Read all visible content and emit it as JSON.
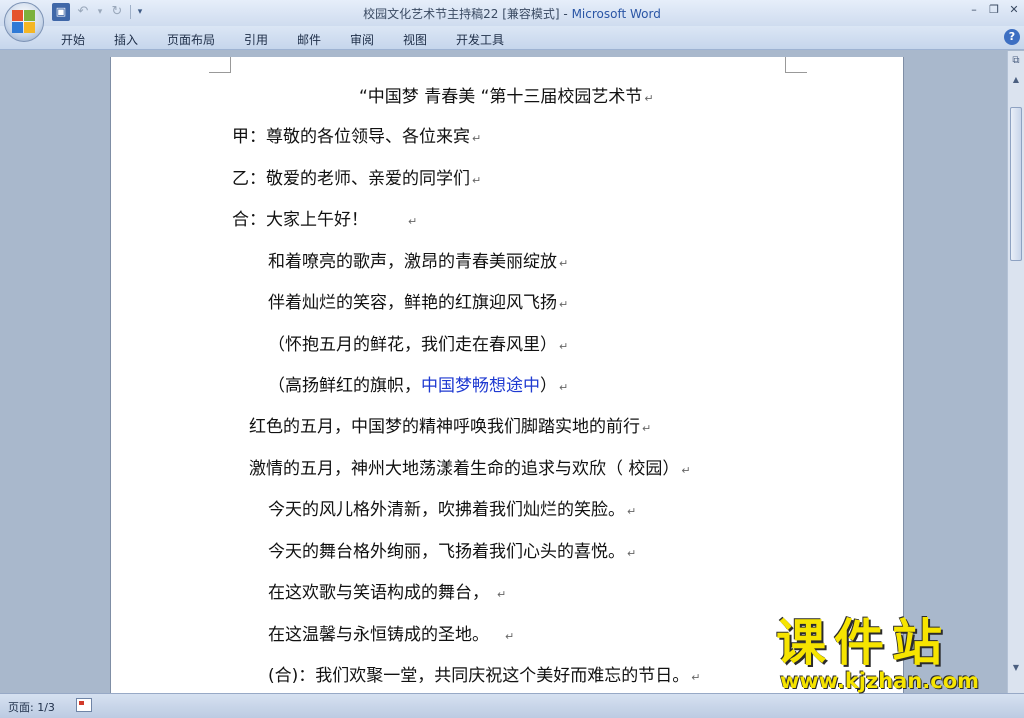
{
  "window": {
    "title": "校园文化艺术节主持稿22 [兼容模式]",
    "separator": " - ",
    "app_name": "Microsoft Word",
    "minimize_glyph": "–",
    "restore_glyph": "❐",
    "close_glyph": "✕"
  },
  "quick_access": {
    "save_glyph": "▣",
    "undo_glyph": "↶",
    "undo_drop_glyph": "▾",
    "redo_glyph": "↻",
    "customize_glyph": "▾"
  },
  "tabs": [
    {
      "label": "开始"
    },
    {
      "label": "插入"
    },
    {
      "label": "页面布局"
    },
    {
      "label": "引用"
    },
    {
      "label": "邮件"
    },
    {
      "label": "审阅"
    },
    {
      "label": "视图"
    },
    {
      "label": "开发工具"
    }
  ],
  "help_glyph": "?",
  "document": {
    "title": "“中国梦 青春美 “第十三届校园艺术节",
    "paragraph_mark": "↵",
    "lines": [
      {
        "text": "甲：尊敬的各位领导、各位来宾"
      },
      {
        "text": "乙：敬爱的老师、亲爱的同学们"
      },
      {
        "text": "合：大家上午好！"
      },
      {
        "text": "和着嘹亮的歌声，激昂的青春美丽绽放"
      },
      {
        "text": "伴着灿烂的笑容，鲜艳的红旗迎风飞扬"
      },
      {
        "text": "（怀抱五月的鲜花，我们走在春风里）"
      },
      {
        "text": "（高扬鲜红的旗帜，",
        "blue": "中国梦畅想途中",
        "tail": "）"
      },
      {
        "text": "红色的五月，中国梦的精神呼唤我们脚踏实地的前行"
      },
      {
        "text": "激情的五月，神州大地荡漾着生命的追求与欢欣（ 校园）"
      },
      {
        "text": "今天的风儿格外清新，吹拂着我们灿烂的笑脸。"
      },
      {
        "text": "今天的舞台格外绚丽，飞扬着我们心头的喜悦。"
      },
      {
        "text": "在这欢歌与笑语构成的舞台，"
      },
      {
        "text": "在这温馨与永恒铸成的圣地。"
      },
      {
        "text": "(合)：我们欢聚一堂，共同庆祝这个美好而难忘的节日。"
      }
    ]
  },
  "scrollbar": {
    "top_glyph": "⧉",
    "up_glyph": "▲",
    "down_glyph": "▼"
  },
  "status": {
    "page_info": "页面: 1/3"
  },
  "watermark": {
    "main": "课件站",
    "url": "www.kjzhan.com"
  }
}
